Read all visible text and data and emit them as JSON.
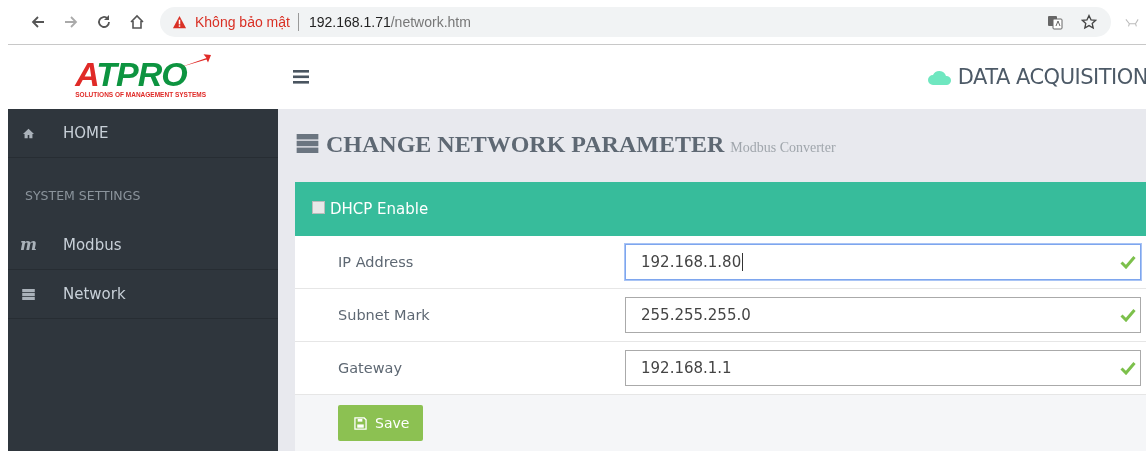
{
  "browser": {
    "security_label": "Không bảo mật",
    "url_host": "192.168.1.71",
    "url_path": "/network.htm"
  },
  "logo": {
    "name": "ATPRO",
    "tagline": "SOLUTIONS OF MANAGEMENT SYSTEMS"
  },
  "header": {
    "title": "DATA ACQUISITION"
  },
  "sidebar": {
    "items": [
      {
        "kind": "home",
        "label": "HOME",
        "selected": false
      },
      {
        "kind": "section",
        "label": "SYSTEM SETTINGS"
      },
      {
        "kind": "glyph",
        "glyph": "m",
        "label": "Modbus",
        "selected": false
      },
      {
        "kind": "server",
        "label": "Network",
        "selected": false
      }
    ]
  },
  "page": {
    "title": "CHANGE NETWORK PARAMETER",
    "subtitle": "Modbus Converter",
    "dhcp": {
      "label": "DHCP Enable",
      "checked": false
    },
    "fields": [
      {
        "label": "IP Address",
        "value": "192.168.1.80",
        "focused": true,
        "valid": true
      },
      {
        "label": "Subnet Mark",
        "value": "255.255.255.0",
        "focused": false,
        "valid": true
      },
      {
        "label": "Gateway",
        "value": "192.168.1.1",
        "focused": false,
        "valid": true
      }
    ],
    "save_button": "Save"
  }
}
